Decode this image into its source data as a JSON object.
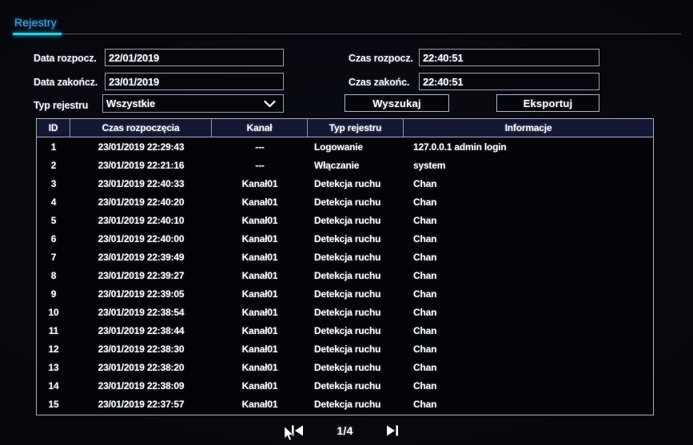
{
  "tab": {
    "label": "Rejestry",
    "accent": "#3ea9ef",
    "underline_color": "#22d3ee"
  },
  "form": {
    "date_start": {
      "label": "Data rozpocz.",
      "value": "22/01/2019"
    },
    "date_end": {
      "label": "Data zakończ.",
      "value": "23/01/2019"
    },
    "log_type": {
      "label": "Typ rejestru",
      "value": "Wszystkie",
      "chevron_icon": "chevron-down-icon"
    },
    "time_start": {
      "label": "Czas rozpocz.",
      "value": "22:40:51"
    },
    "time_end": {
      "label": "Czas zakońc.",
      "value": "22:40:51"
    },
    "search_button": "Wyszukaj",
    "export_button": "Eksportuj"
  },
  "table": {
    "columns": [
      "ID",
      "Czas rozpoczęcia",
      "Kanał",
      "Typ rejestru",
      "Informacje"
    ],
    "rows": [
      {
        "id": "1",
        "time": "23/01/2019 22:29:43",
        "channel": "---",
        "type": "Logowanie",
        "info": "127.0.0.1 admin  login"
      },
      {
        "id": "2",
        "time": "23/01/2019 22:21:16",
        "channel": "---",
        "type": "Włączanie",
        "info": "system"
      },
      {
        "id": "3",
        "time": "23/01/2019 22:40:33",
        "channel": "Kanał01",
        "type": "Detekcja ruchu",
        "info": "Chan"
      },
      {
        "id": "4",
        "time": "23/01/2019 22:40:20",
        "channel": "Kanał01",
        "type": "Detekcja ruchu",
        "info": "Chan"
      },
      {
        "id": "5",
        "time": "23/01/2019 22:40:10",
        "channel": "Kanał01",
        "type": "Detekcja ruchu",
        "info": "Chan"
      },
      {
        "id": "6",
        "time": "23/01/2019 22:40:00",
        "channel": "Kanał01",
        "type": "Detekcja ruchu",
        "info": "Chan"
      },
      {
        "id": "7",
        "time": "23/01/2019 22:39:49",
        "channel": "Kanał01",
        "type": "Detekcja ruchu",
        "info": "Chan"
      },
      {
        "id": "8",
        "time": "23/01/2019 22:39:27",
        "channel": "Kanał01",
        "type": "Detekcja ruchu",
        "info": "Chan"
      },
      {
        "id": "9",
        "time": "23/01/2019 22:39:05",
        "channel": "Kanał01",
        "type": "Detekcja ruchu",
        "info": "Chan"
      },
      {
        "id": "10",
        "time": "23/01/2019 22:38:54",
        "channel": "Kanał01",
        "type": "Detekcja ruchu",
        "info": "Chan"
      },
      {
        "id": "11",
        "time": "23/01/2019 22:38:44",
        "channel": "Kanał01",
        "type": "Detekcja ruchu",
        "info": "Chan"
      },
      {
        "id": "12",
        "time": "23/01/2019 22:38:30",
        "channel": "Kanał01",
        "type": "Detekcja ruchu",
        "info": "Chan"
      },
      {
        "id": "13",
        "time": "23/01/2019 22:38:20",
        "channel": "Kanał01",
        "type": "Detekcja ruchu",
        "info": "Chan"
      },
      {
        "id": "14",
        "time": "23/01/2019 22:38:09",
        "channel": "Kanał01",
        "type": "Detekcja ruchu",
        "info": "Chan"
      },
      {
        "id": "15",
        "time": "23/01/2019 22:37:57",
        "channel": "Kanał01",
        "type": "Detekcja ruchu",
        "info": "Chan"
      }
    ]
  },
  "pagination": {
    "first_icon": "first-page-icon",
    "last_icon": "last-page-icon",
    "page_label": "1/4"
  }
}
